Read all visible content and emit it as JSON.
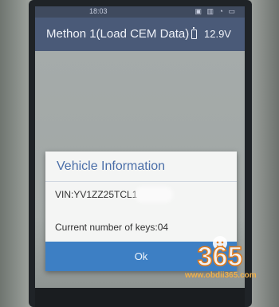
{
  "status_bar": {
    "time": "18:03",
    "icons": "▣ ▥ ◔ ▭"
  },
  "header": {
    "title": "Methon 1(Load CEM Data)",
    "battery_icon": "battery-icon",
    "voltage": "12.9V"
  },
  "dialog": {
    "title": "Vehicle Information",
    "vin_label": "VIN:YV1ZZ25TCL1",
    "keys_text": "Current number of keys:04",
    "ok_label": "Ok"
  },
  "watermark": {
    "logo_text": "365",
    "url": "www.obdii365.com"
  },
  "colors": {
    "header": "#4a5a78",
    "dialog_title": "#4a6ea8",
    "ok_button": "#3d7fc4",
    "watermark": "#f0b04a"
  }
}
